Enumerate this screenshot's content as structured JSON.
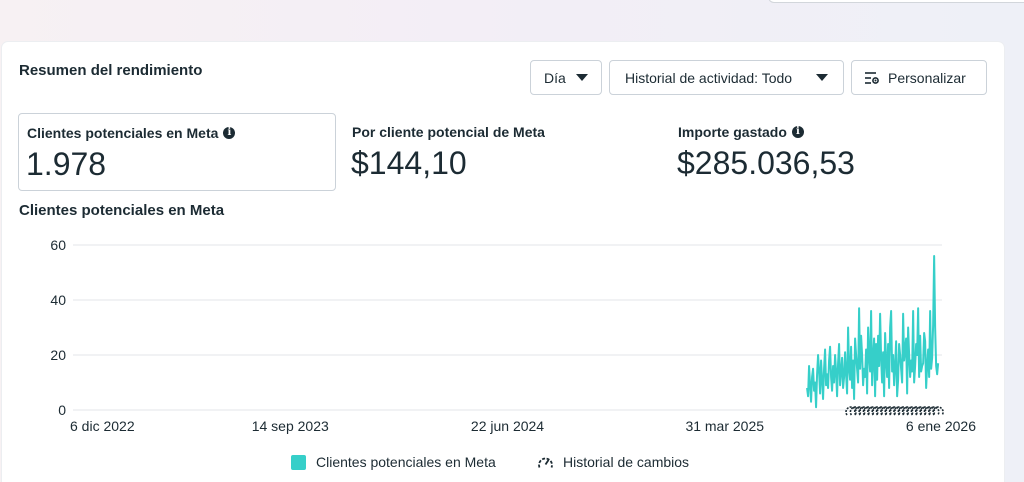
{
  "header": {
    "title": "Resumen del rendimiento"
  },
  "toolbar": {
    "day_label": "Día",
    "activity_label": "Historial de actividad: Todo",
    "customize_label": "Personalizar"
  },
  "metrics": [
    {
      "label": "Clientes potenciales en Meta",
      "value": "1.978",
      "has_info": true,
      "selected": true
    },
    {
      "label": "Por cliente potencial de Meta",
      "value": "$144,10",
      "has_info": false,
      "selected": false
    },
    {
      "label": "Importe gastado",
      "value": "$285.036,53",
      "has_info": true,
      "selected": false
    }
  ],
  "chart_title": "Clientes potenciales en Meta",
  "colors": {
    "series": "#36cfc9",
    "grid": "#e3e6ea",
    "text": "#1c2b33"
  },
  "chart_data": {
    "type": "line",
    "ylim": [
      0,
      60
    ],
    "y_ticks": [
      "0",
      "20",
      "40",
      "60"
    ],
    "x_tick_labels": [
      "6 dic 2022",
      "14 sep 2023",
      "22 jun 2024",
      "31 mar 2025",
      "6 ene 2026"
    ],
    "x_range": [
      "2022-12-06",
      "2026-01-06"
    ],
    "series": [
      {
        "name": "Clientes potenciales en Meta",
        "x_start": "2025-07-15",
        "values": [
          8,
          5,
          16,
          9,
          3,
          12,
          15,
          7,
          10,
          1,
          13,
          20,
          14,
          6,
          18,
          11,
          4,
          15,
          22,
          9,
          13,
          8,
          18,
          23,
          12,
          7,
          16,
          10,
          20,
          14,
          5,
          17,
          24,
          9,
          14,
          19,
          8,
          12,
          21,
          13,
          6,
          30,
          15,
          11,
          23,
          8,
          18,
          4,
          26,
          20,
          15,
          10,
          37,
          15,
          27,
          20,
          9,
          15,
          12,
          22,
          6,
          30,
          20,
          14,
          36,
          9,
          19,
          26,
          5,
          24,
          11,
          27,
          16,
          35,
          19,
          10,
          21,
          5,
          28,
          18,
          12,
          24,
          8,
          30,
          36,
          14,
          20,
          9,
          16,
          25,
          5,
          11,
          24,
          20,
          15,
          10,
          35,
          18,
          22,
          26,
          6,
          30,
          20,
          12,
          18,
          14,
          36,
          10,
          16,
          24,
          20,
          37,
          12,
          27,
          14,
          16,
          17,
          28,
          25,
          8,
          16,
          22,
          12,
          36,
          15,
          19,
          31,
          56,
          30,
          16,
          13,
          17
        ]
      }
    ],
    "markers": {
      "name": "Historial de cambios",
      "x_start": "2025-09-10",
      "x_end": "2026-01-01",
      "count": 21
    }
  },
  "legend": [
    {
      "label": "Clientes potenciales en Meta",
      "icon": "teal-square"
    },
    {
      "label": "Historial de cambios",
      "icon": "gauge-icon"
    }
  ]
}
